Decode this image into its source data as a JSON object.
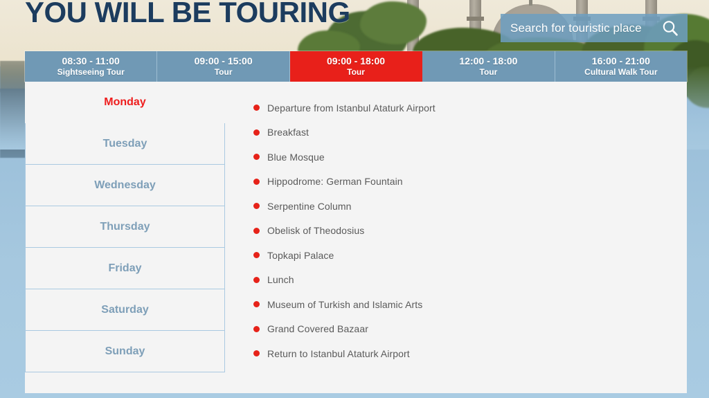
{
  "header": {
    "title": "YOU WILL BE TOURING"
  },
  "search": {
    "placeholder": "Search for touristic place",
    "value": "",
    "icon": "search-icon"
  },
  "tabs": [
    {
      "time": "08:30 - 11:00",
      "label": "Sightseeing Tour",
      "active": false
    },
    {
      "time": "09:00 - 15:00",
      "label": "Tour",
      "active": false
    },
    {
      "time": "09:00 - 18:00",
      "label": "Tour",
      "active": true
    },
    {
      "time": "12:00 - 18:00",
      "label": "Tour",
      "active": false
    },
    {
      "time": "16:00 - 21:00",
      "label": "Cultural Walk Tour",
      "active": false
    }
  ],
  "days": [
    {
      "label": "Monday",
      "active": true
    },
    {
      "label": "Tuesday",
      "active": false
    },
    {
      "label": "Wednesday",
      "active": false
    },
    {
      "label": "Thursday",
      "active": false
    },
    {
      "label": "Friday",
      "active": false
    },
    {
      "label": "Saturday",
      "active": false
    },
    {
      "label": "Sunday",
      "active": false
    }
  ],
  "itinerary": [
    {
      "text": "Departure from Istanbul Ataturk Airport"
    },
    {
      "text": "Breakfast"
    },
    {
      "text": "Blue Mosque"
    },
    {
      "text": "Hippodrome: German Fountain"
    },
    {
      "text": "Serpentine Column"
    },
    {
      "text": "Obelisk of Theodosius"
    },
    {
      "text": "Topkapi Palace"
    },
    {
      "text": "Lunch"
    },
    {
      "text": "Museum of Turkish and Islamic Arts"
    },
    {
      "text": "Grand Covered Bazaar"
    },
    {
      "text": "Return to Istanbul Ataturk Airport"
    }
  ],
  "colors": {
    "title": "#1c3c5e",
    "tab_bg": "#7099b5",
    "tab_active_bg": "#e8201a",
    "day_text": "#7e9fb8",
    "day_active_text": "#ee1d1d",
    "bullet": "#e62219",
    "panel_bg": "#f4f4f4",
    "search_bg": "#6e9ec0",
    "page_bg": "#a9cbe3"
  }
}
